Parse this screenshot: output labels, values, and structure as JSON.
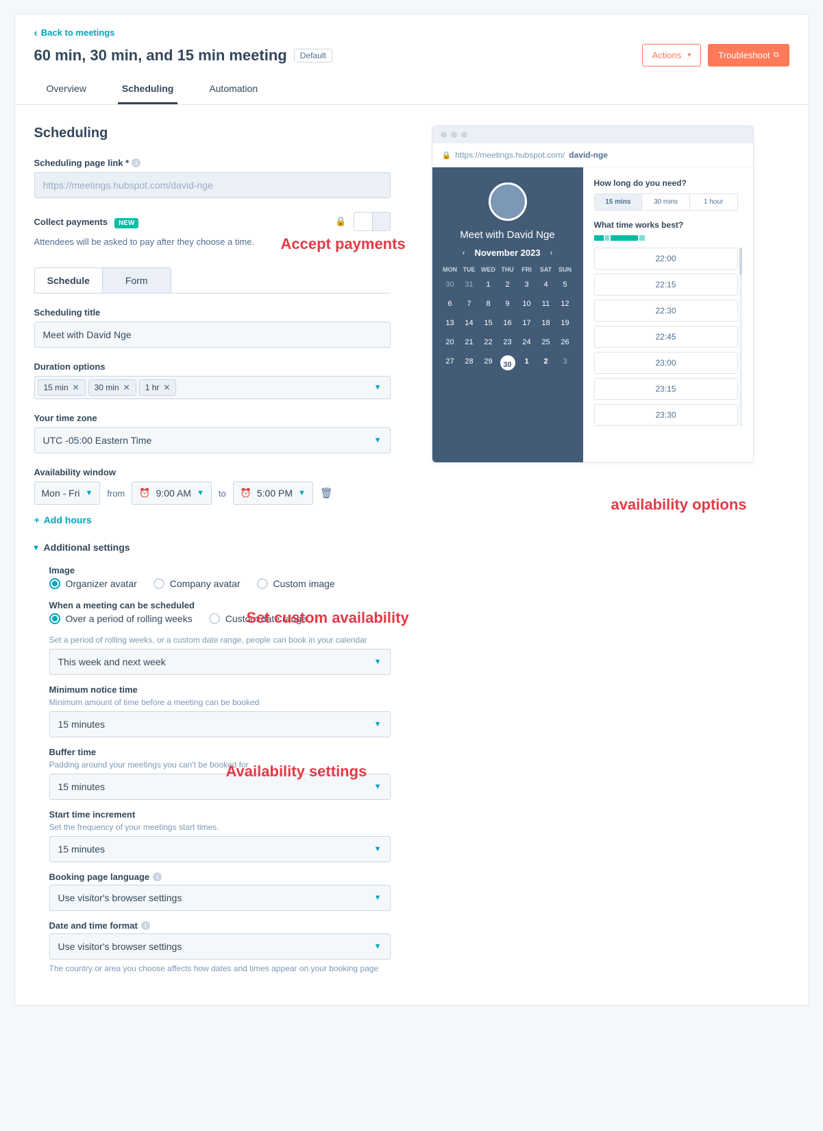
{
  "nav": {
    "back": "Back to meetings",
    "title": "60 min, 30 min, and 15 min meeting",
    "default_badge": "Default",
    "actions_btn": "Actions",
    "troubleshoot_btn": "Troubleshoot"
  },
  "tabs": {
    "overview": "Overview",
    "scheduling": "Scheduling",
    "automation": "Automation"
  },
  "section_heading": "Scheduling",
  "link_field": {
    "label": "Scheduling page link *",
    "value": "https://meetings.hubspot.com/david-nge"
  },
  "payments": {
    "label": "Collect payments",
    "new": "NEW",
    "desc": "Attendees will be asked to pay after they choose a time."
  },
  "sub_tabs": {
    "schedule": "Schedule",
    "form": "Form"
  },
  "sched_title": {
    "label": "Scheduling title",
    "value": "Meet with David Nge"
  },
  "duration": {
    "label": "Duration options",
    "chips": [
      "15 min",
      "30 min",
      "1 hr"
    ]
  },
  "timezone": {
    "label": "Your time zone",
    "value": "UTC -05:00 Eastern Time"
  },
  "avail_window": {
    "label": "Availability window",
    "days": "Mon - Fri",
    "from_label": "from",
    "from": "9:00 AM",
    "to_label": "to",
    "to": "5:00 PM",
    "add_hours": "Add hours"
  },
  "additional": {
    "header": "Additional settings",
    "image_label": "Image",
    "image_opts": {
      "organizer": "Organizer avatar",
      "company": "Company avatar",
      "custom": "Custom image"
    },
    "when_label": "When a meeting can be scheduled",
    "when_opts": {
      "rolling": "Over a period of rolling weeks",
      "range": "Custom date range"
    },
    "rolling_hint": "Set a period of rolling weeks, or a custom date range, people can book in your calendar",
    "rolling_value": "This week and next week",
    "min_notice_label": "Minimum notice time",
    "min_notice_hint": "Minimum amount of time before a meeting can be booked",
    "min_notice_value": "15 minutes",
    "buffer_label": "Buffer time",
    "buffer_hint": "Padding around your meetings you can't be booked for",
    "buffer_value": "15 minutes",
    "increment_label": "Start time increment",
    "increment_hint": "Set the frequency of your meetings start times.",
    "increment_value": "15 minutes",
    "lang_label": "Booking page language",
    "lang_value": "Use visitor's browser settings",
    "datefmt_label": "Date and time format",
    "datefmt_value": "Use visitor's browser settings",
    "datefmt_hint": "The country or area you choose affects how dates and times appear on your booking page"
  },
  "preview": {
    "url_prefix": "https://meetings.hubspot.com/",
    "url_slug": "david-nge",
    "meet_title": "Meet with David Nge",
    "month": "November 2023",
    "dow": [
      "MON",
      "TUE",
      "WED",
      "THU",
      "FRI",
      "SAT",
      "SUN"
    ],
    "weeks": [
      [
        {
          "d": "30",
          "in": false
        },
        {
          "d": "31",
          "in": false
        },
        {
          "d": "1",
          "in": true
        },
        {
          "d": "2",
          "in": true
        },
        {
          "d": "3",
          "in": true
        },
        {
          "d": "4",
          "in": true
        },
        {
          "d": "5",
          "in": true
        }
      ],
      [
        {
          "d": "6",
          "in": true
        },
        {
          "d": "7",
          "in": true
        },
        {
          "d": "8",
          "in": true
        },
        {
          "d": "9",
          "in": true
        },
        {
          "d": "10",
          "in": true
        },
        {
          "d": "11",
          "in": true
        },
        {
          "d": "12",
          "in": true
        }
      ],
      [
        {
          "d": "13",
          "in": true
        },
        {
          "d": "14",
          "in": true
        },
        {
          "d": "15",
          "in": true
        },
        {
          "d": "16",
          "in": true
        },
        {
          "d": "17",
          "in": true
        },
        {
          "d": "18",
          "in": true
        },
        {
          "d": "19",
          "in": true
        }
      ],
      [
        {
          "d": "20",
          "in": true
        },
        {
          "d": "21",
          "in": true
        },
        {
          "d": "22",
          "in": true
        },
        {
          "d": "23",
          "in": true
        },
        {
          "d": "24",
          "in": true
        },
        {
          "d": "25",
          "in": true
        },
        {
          "d": "26",
          "in": true
        }
      ],
      [
        {
          "d": "27",
          "in": true
        },
        {
          "d": "28",
          "in": true
        },
        {
          "d": "29",
          "in": true
        },
        {
          "d": "30",
          "in": true,
          "sel": true
        },
        {
          "d": "1",
          "in": false,
          "bold": true
        },
        {
          "d": "2",
          "in": false,
          "bold": true
        },
        {
          "d": "3",
          "in": false
        }
      ]
    ],
    "q1": "How long do you need?",
    "dur_opts": [
      "15 mins",
      "30 mins",
      "1 hour"
    ],
    "q2": "What time works best?",
    "slots": [
      "22:00",
      "22:15",
      "22:30",
      "22:45",
      "23:00",
      "23:15",
      "23:30"
    ]
  },
  "annotations": {
    "accept": "Accept payments",
    "avail_opts": "availability options",
    "custom_avail": "Set custom availability",
    "avail_settings": "Availability settings"
  }
}
